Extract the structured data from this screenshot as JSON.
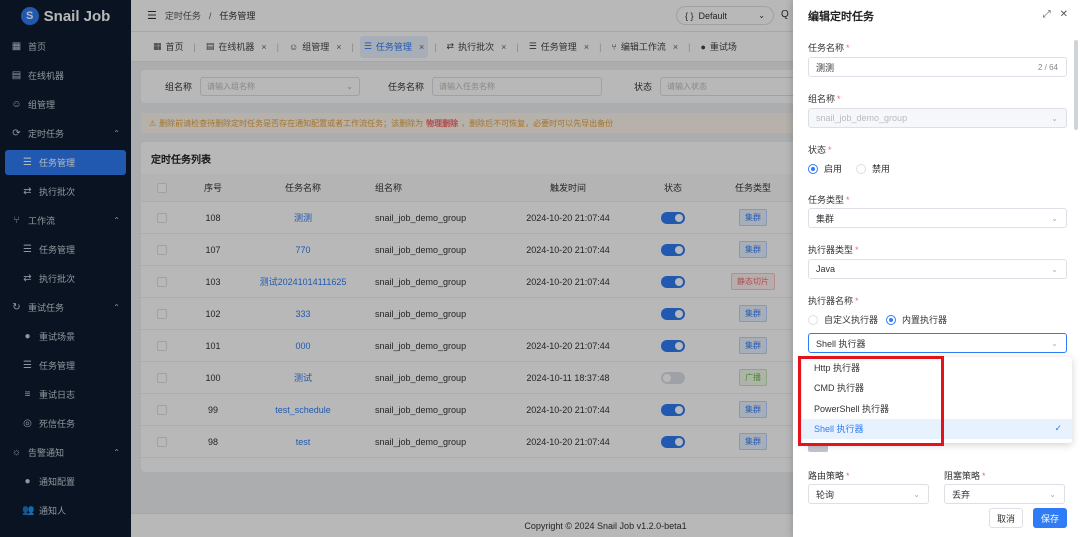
{
  "app": {
    "logo_letter": "S",
    "title": "Snail Job"
  },
  "sidebar": {
    "items": [
      {
        "icon": "▦",
        "label": "首页",
        "level": 0
      },
      {
        "icon": "▤",
        "label": "在线机器",
        "level": 0
      },
      {
        "icon": "☺",
        "label": "组管理",
        "level": 0
      },
      {
        "icon": "⟳",
        "label": "定时任务",
        "level": 0,
        "expanded": true
      },
      {
        "icon": "☰",
        "label": "任务管理",
        "level": 1,
        "active": true
      },
      {
        "icon": "⇄",
        "label": "执行批次",
        "level": 1
      },
      {
        "icon": "⑂",
        "label": "工作流",
        "level": 0,
        "expanded": true
      },
      {
        "icon": "☰",
        "label": "任务管理",
        "level": 1
      },
      {
        "icon": "⇄",
        "label": "执行批次",
        "level": 1
      },
      {
        "icon": "↻",
        "label": "重试任务",
        "level": 0,
        "expanded": true
      },
      {
        "icon": "●",
        "label": "重试场景",
        "level": 1
      },
      {
        "icon": "☰",
        "label": "任务管理",
        "level": 1
      },
      {
        "icon": "≡",
        "label": "重试日志",
        "level": 1
      },
      {
        "icon": "◎",
        "label": "死信任务",
        "level": 1
      },
      {
        "icon": "☼",
        "label": "告警通知",
        "level": 0,
        "expanded": true
      },
      {
        "icon": "●",
        "label": "通知配置",
        "level": 1
      },
      {
        "icon": "👥",
        "label": "通知人",
        "level": 1
      }
    ]
  },
  "topbar": {
    "breadcrumb_parent": "定时任务",
    "breadcrumb_sep": "/",
    "breadcrumb_current": "任务管理",
    "env_label": "Default"
  },
  "tabs": [
    {
      "icon": "▦",
      "label": "首页"
    },
    {
      "icon": "▤",
      "label": "在线机器"
    },
    {
      "icon": "☺",
      "label": "组管理"
    },
    {
      "icon": "☰",
      "label": "任务管理",
      "active": true
    },
    {
      "icon": "⇄",
      "label": "执行批次"
    },
    {
      "icon": "☰",
      "label": "任务管理"
    },
    {
      "icon": "⑂",
      "label": "编辑工作流"
    },
    {
      "icon": "●",
      "label": "重试场"
    }
  ],
  "search": {
    "group_label": "组名称",
    "group_placeholder": "请输入组名称",
    "task_label": "任务名称",
    "task_placeholder": "请输入任务名称",
    "status_label": "状态",
    "status_placeholder": "请输入状态"
  },
  "warning": {
    "prefix": "删除前请检查待删除定时任务是否存在通知配置或者工作流任务；该删除为",
    "emphasis": "物理删除",
    "suffix": "，删除后不可恢复，必要时可以先导出备份"
  },
  "table": {
    "title": "定时任务列表",
    "columns": [
      "序号",
      "任务名称",
      "组名称",
      "触发时间",
      "状态",
      "任务类型"
    ],
    "rows": [
      {
        "id": "108",
        "name": "测测",
        "group": "snail_job_demo_group",
        "time": "2024-10-20 21:07:44",
        "on": true,
        "type": "集群",
        "type_style": "cluster"
      },
      {
        "id": "107",
        "name": "770",
        "group": "snail_job_demo_group",
        "time": "2024-10-20 21:07:44",
        "on": true,
        "type": "集群",
        "type_style": "cluster"
      },
      {
        "id": "103",
        "name": "测试20241014111625",
        "group": "snail_job_demo_group",
        "time": "2024-10-20 21:07:44",
        "on": true,
        "type": "静态切片",
        "type_style": "slice"
      },
      {
        "id": "102",
        "name": "333",
        "group": "snail_job_demo_group",
        "time": "",
        "on": true,
        "type": "集群",
        "type_style": "cluster"
      },
      {
        "id": "101",
        "name": "000",
        "group": "snail_job_demo_group",
        "time": "2024-10-20 21:07:44",
        "on": true,
        "type": "集群",
        "type_style": "cluster"
      },
      {
        "id": "100",
        "name": "测试",
        "group": "snail_job_demo_group",
        "time": "2024-10-11 18:37:48",
        "on": false,
        "type": "广播",
        "type_style": "broadcast"
      },
      {
        "id": "99",
        "name": "test_schedule",
        "group": "snail_job_demo_group",
        "time": "2024-10-20 21:07:44",
        "on": true,
        "type": "集群",
        "type_style": "cluster"
      },
      {
        "id": "98",
        "name": "test",
        "group": "snail_job_demo_group",
        "time": "2024-10-20 21:07:44",
        "on": true,
        "type": "集群",
        "type_style": "cluster"
      }
    ]
  },
  "footer": {
    "copyright": "Copyright © 2024 Snail Job v1.2.0-beta1"
  },
  "drawer": {
    "title": "编辑定时任务",
    "task_name_label": "任务名称",
    "task_name_value": "测测",
    "task_name_count": "2 / 64",
    "group_label": "组名称",
    "group_value": "snail_job_demo_group",
    "status_label": "状态",
    "status_on": "启用",
    "status_off": "禁用",
    "task_type_label": "任务类型",
    "task_type_value": "集群",
    "executor_type_label": "执行器类型",
    "executor_type_value": "Java",
    "executor_name_label": "执行器名称",
    "executor_custom": "自定义执行器",
    "executor_builtin": "内置执行器",
    "executor_value": "Shell 执行器",
    "options": [
      "Http 执行器",
      "CMD 执行器",
      "PowerShell 执行器",
      "Shell 执行器"
    ],
    "route_label": "路由策略",
    "route_value": "轮询",
    "block_label": "阻塞策略",
    "block_value": "丢弃",
    "cancel": "取消",
    "save": "保存",
    "required_mark": "*"
  }
}
